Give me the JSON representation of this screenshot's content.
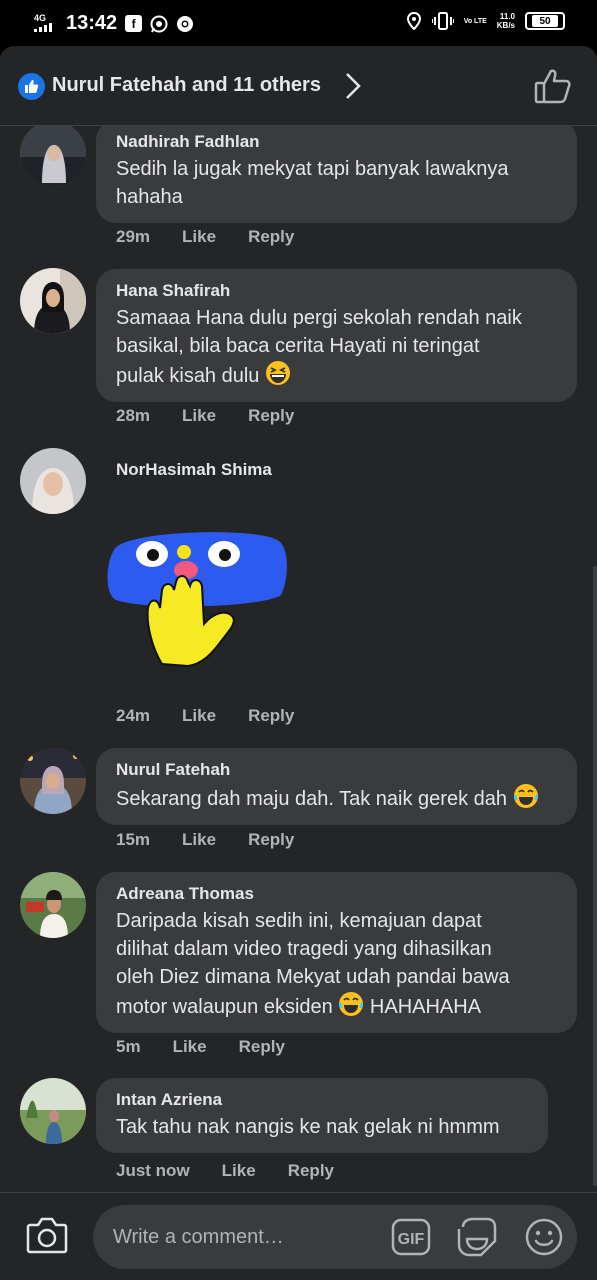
{
  "status_bar": {
    "network": "4G",
    "time": "13:42",
    "app_icons": [
      "facebook-icon",
      "whatsapp-icon",
      "chrome-icon"
    ],
    "volte": "Vo LTE",
    "speed_value": "11.0",
    "speed_unit": "KB/s",
    "battery": "50"
  },
  "reactions": {
    "summary": "Nurul Fatehah and 11 others",
    "badge_icon": "like-icon",
    "like_button_icon": "thumbs-up-icon"
  },
  "comments": [
    {
      "author": "Nadhirah Fadhlan",
      "text_lines": [
        "Sedih la jugak mekyat tapi banyak lawaknya",
        "hahaha"
      ],
      "time": "29m",
      "like": "Like",
      "reply": "Reply"
    },
    {
      "author": "Hana Shafirah",
      "text_lines": [
        "Samaaa Hana dulu pergi sekolah rendah naik",
        "basikal, bila baca cerita Hayati ni teringat",
        "pulak kisah dulu"
      ],
      "emoji": "grinning-squinting-emoji",
      "time": "28m",
      "like": "Like",
      "reply": "Reply"
    },
    {
      "author": "NorHasimah Shima",
      "sticker": "peeking-hand-sticker",
      "time": "24m",
      "like": "Like",
      "reply": "Reply"
    },
    {
      "author": "Nurul Fatehah",
      "text_lines": [
        "Sekarang dah maju dah. Tak naik gerek dah"
      ],
      "emoji": "tears-of-joy-emoji",
      "time": "15m",
      "like": "Like",
      "reply": "Reply"
    },
    {
      "author": "Adreana Thomas",
      "text_lines": [
        "Daripada kisah sedih ini, kemajuan dapat",
        "dilihat dalam video tragedi yang dihasilkan",
        "oleh Diez dimana Mekyat udah pandai bawa",
        "motor walaupun eksiden",
        "HAHAHAHA"
      ],
      "emoji": "tears-of-joy-emoji",
      "time": "5m",
      "like": "Like",
      "reply": "Reply"
    },
    {
      "author": "Intan Azriena",
      "text_lines": [
        "Tak tahu nak nangis ke nak gelak ni hmmm"
      ],
      "time": "Just now",
      "like": "Like",
      "reply": "Reply"
    }
  ],
  "composer": {
    "placeholder": "Write a comment…",
    "camera_icon": "camera-icon",
    "gif_label": "GIF",
    "sticker_icon": "sticker-icon",
    "emoji_icon": "smiley-icon"
  },
  "colors": {
    "background": "#242526",
    "bubble": "#3a3b3c",
    "text": "#e4e6eb",
    "secondary_text": "#b0b3b8",
    "brand_blue": "#1b74e4"
  }
}
